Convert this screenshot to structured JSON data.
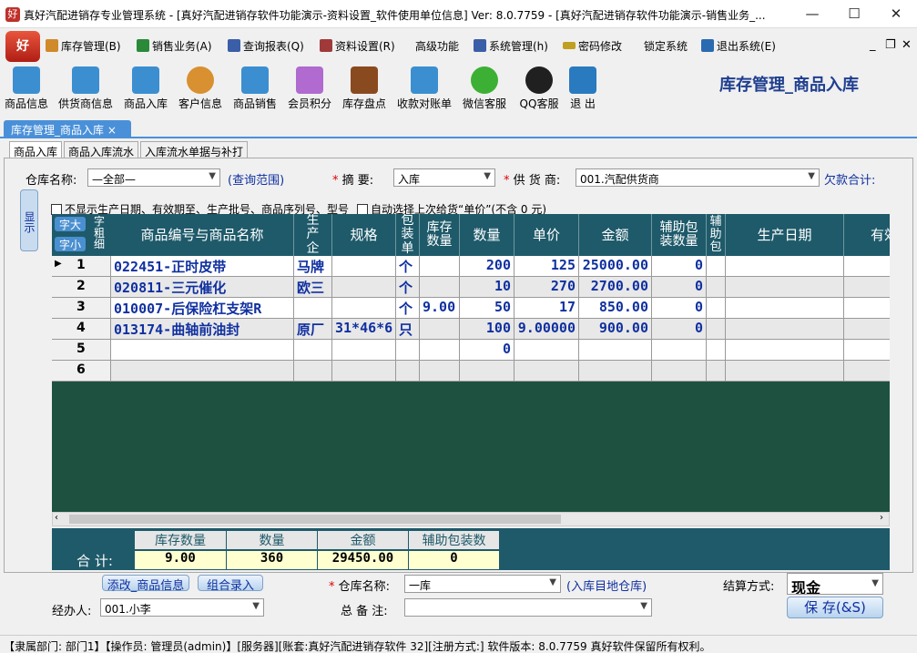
{
  "window": {
    "title": "真好汽配进销存专业管理系统 - [真好汽配进销存软件功能演示-资料设置_软件使用单位信息]    Ver: 8.0.7759 - [真好汽配进销存软件功能演示-销售业务_...",
    "app_icon_glyph": "好",
    "minimize": "—",
    "maximize": "☐",
    "close": "✕"
  },
  "menu": {
    "logo": "好",
    "items": [
      {
        "label": "库存管理(B)",
        "color": "#d08a2a"
      },
      {
        "label": "销售业务(A)",
        "color": "#2a8a3a"
      },
      {
        "label": "查询报表(Q)",
        "color": "#3a5fa8"
      },
      {
        "label": "资料设置(R)",
        "color": "#a03a3a"
      },
      {
        "label": "高级功能",
        "color": ""
      },
      {
        "label": "系统管理(h)",
        "color": "#3a5fa8"
      },
      {
        "label": "密码修改",
        "color": "#c0a020"
      },
      {
        "label": "锁定系统",
        "color": ""
      },
      {
        "label": "退出系统(E)",
        "color": "#2a6ab0"
      }
    ],
    "mdi_min": "_",
    "mdi_restore": "❐",
    "mdi_close": "✕"
  },
  "toolbar": {
    "buttons": [
      {
        "label": "商品信息",
        "color": "#3b8fd0"
      },
      {
        "label": "供货商信息",
        "color": "#3b8fd0"
      },
      {
        "label": "商品入库",
        "color": "#3b8fd0"
      },
      {
        "label": "客户信息",
        "color": "#d89030"
      },
      {
        "label": "商品销售",
        "color": "#3b8fd0"
      },
      {
        "label": "会员积分",
        "color": "#b06ad0"
      },
      {
        "label": "库存盘点",
        "color": "#8a4a20"
      },
      {
        "label": "收款对账单",
        "color": "#3b8fd0"
      },
      {
        "label": "微信客服",
        "color": "#3cb034"
      },
      {
        "label": "QQ客服",
        "color": "#202020"
      },
      {
        "label": "退 出",
        "color": "#2a7ac0"
      }
    ],
    "heading": "库存管理_商品入库"
  },
  "tabs": {
    "main_tab": "库存管理_商品入库  ×",
    "sub_tabs": [
      "商品入库",
      "商品入库流水",
      "入库流水单据与补打"
    ]
  },
  "form": {
    "warehouse_label": "仓库名称:",
    "warehouse_value": "—全部—",
    "scope_label": "(查询范围)",
    "summary_label": "摘  要:",
    "summary_value": "入库",
    "supplier_label": "供 货 商:",
    "supplier_value": "001.汽配供货商",
    "debt_label": "欠款合计:",
    "side_show": "显示",
    "hide_dates_label": "不显示生产日期、有效期至、生产批号、商品序列号、型号",
    "auto_price_label": "自动选择上次给货“单价”(不含 0 元)",
    "font_big": "字大",
    "font_small": "字小",
    "font_weight": "字粗细"
  },
  "grid": {
    "headers": [
      "商品编号与商品名称",
      "生产企",
      "规格",
      "包装单",
      "库存数量",
      "数量",
      "单价",
      "金额",
      "辅助包装数量",
      "辅助包",
      "生产日期",
      "有效"
    ],
    "rows": [
      {
        "n": "1",
        "name": "022451-正时皮带",
        "maker": "马牌",
        "spec": "",
        "unit": "个",
        "stock": "",
        "qty": "200",
        "price": "125",
        "amount": "25000.00",
        "aux": "0",
        "marker": "▶"
      },
      {
        "n": "2",
        "name": "020811-三元催化",
        "maker": "欧三",
        "spec": "",
        "unit": "个",
        "stock": "",
        "qty": "10",
        "price": "270",
        "amount": "2700.00",
        "aux": "0",
        "marker": ""
      },
      {
        "n": "3",
        "name": "010007-后保险杠支架R",
        "maker": "",
        "spec": "",
        "unit": "个",
        "stock": "9.00",
        "qty": "50",
        "price": "17",
        "amount": "850.00",
        "aux": "0",
        "marker": ""
      },
      {
        "n": "4",
        "name": "013174-曲轴前油封",
        "maker": "原厂",
        "spec": "31*46*6",
        "unit": "只",
        "stock": "",
        "qty": "100",
        "price": "9.00000",
        "amount": "900.00",
        "aux": "0",
        "marker": ""
      },
      {
        "n": "5",
        "name": "",
        "maker": "",
        "spec": "",
        "unit": "",
        "stock": "",
        "qty": "0",
        "price": "",
        "amount": "",
        "aux": "",
        "marker": ""
      },
      {
        "n": "6",
        "name": "",
        "maker": "",
        "spec": "",
        "unit": "",
        "stock": "",
        "qty": "",
        "price": "",
        "amount": "",
        "aux": "",
        "marker": ""
      }
    ]
  },
  "totals": {
    "label": "合 计:",
    "headers": [
      "库存数量",
      "数量",
      "金额",
      "辅助包装数"
    ],
    "values": [
      "9.00",
      "360",
      "29450.00",
      "0"
    ]
  },
  "footer": {
    "edit_product": "添改_商品信息",
    "combo_entry": "组合录入",
    "dest_warehouse_label": "仓库名称:",
    "dest_warehouse_value": "一库",
    "dest_warehouse_note": "(入库目地仓库)",
    "settle_label": "结算方式:",
    "settle_value": "现金",
    "handler_label": "经办人:",
    "handler_value": "001.小李",
    "remark_label": "总 备 注:",
    "save": "保  存(&S)"
  },
  "status": "【隶属部门: 部门1】【操作员: 管理员(admin)】[服务器][账套:真好汽配进销存软件 32][注册方式:] 软件版本: 8.0.7759 真好软件保留所有权利。"
}
